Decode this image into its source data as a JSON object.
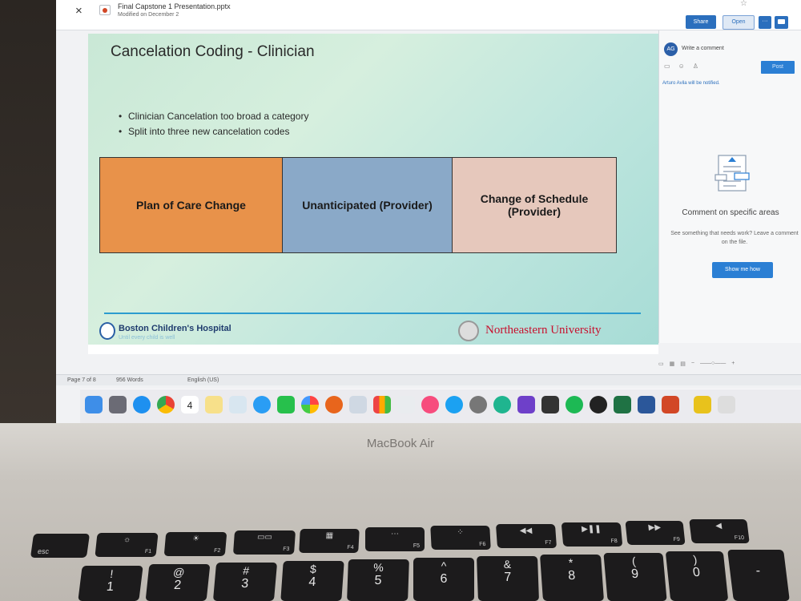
{
  "window": {
    "close_icon": "×",
    "file_name": "Final Capstone 1 Presentation.pptx",
    "modified": "Modified on December 2",
    "share_label": "Share",
    "open_label": "Open",
    "more_label": "···"
  },
  "slide": {
    "title": "Cancelation Coding - Clinician",
    "bullets": [
      "Clinician Cancelation too broad a category",
      "Split into three new cancelation codes"
    ],
    "boxes": [
      {
        "label": "Plan of Care Change",
        "color": "#e8924a"
      },
      {
        "label": "Unanticipated (Provider)",
        "color": "#8aa9c8"
      },
      {
        "label": "Change of Schedule (Provider)",
        "color": "#e6c8bc"
      }
    ],
    "logo_left_name": "Boston Children's Hospital",
    "logo_left_tagline": "Until every child is well",
    "logo_right_name": "Northeastern University"
  },
  "comments": {
    "avatar": "AG",
    "input_placeholder": "Write a comment",
    "post_label": "Post",
    "notify": "Arturo Avila will be notified.",
    "heading": "Comment on specific areas",
    "description": "See something that needs work? Leave a comment on the file.",
    "show_me_label": "Show me how"
  },
  "status": {
    "page": "Page 7 of 8",
    "words": "956 Words",
    "language": "English (US)"
  },
  "laptop": {
    "brand": "MacBook Air",
    "dock_calendar_day": "4"
  },
  "keyboard": {
    "fn_row": [
      "esc",
      "F1",
      "F2",
      "F3",
      "F4",
      "F5",
      "F6",
      "F7",
      "F8",
      "F9",
      "F10"
    ],
    "num_row": [
      {
        "top": "!",
        "main": "1"
      },
      {
        "top": "@",
        "main": "2"
      },
      {
        "top": "#",
        "main": "3"
      },
      {
        "top": "$",
        "main": "4"
      },
      {
        "top": "%",
        "main": "5"
      },
      {
        "top": "^",
        "main": "6"
      },
      {
        "top": "&",
        "main": "7"
      },
      {
        "top": "*",
        "main": "8"
      },
      {
        "top": "(",
        "main": "9"
      },
      {
        "top": ")",
        "main": "0"
      },
      {
        "top": "",
        "main": "-"
      }
    ]
  },
  "colors": {
    "accent": "#2b6fbd",
    "slide_title": "#2a2a2a",
    "divider": "#2c9ccf",
    "northeastern_red": "#c8102e"
  }
}
